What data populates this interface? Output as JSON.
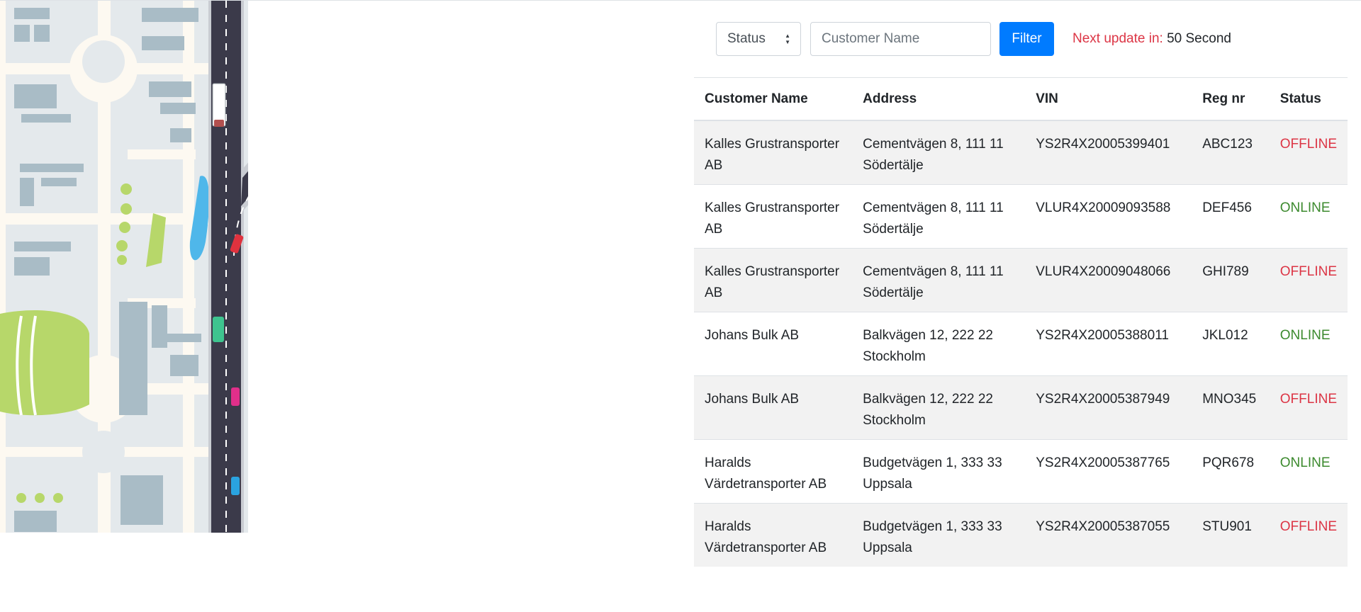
{
  "filter_bar": {
    "status_select_value": "Status",
    "customer_name_placeholder": "Customer Name",
    "filter_button_label": "Filter",
    "next_update_label": "Next update in:",
    "next_update_value": "50 Second"
  },
  "table": {
    "headers": [
      "Customer Name",
      "Address",
      "VIN",
      "Reg nr",
      "Status"
    ],
    "rows": [
      {
        "customer": "Kalles Grustransporter AB",
        "address": "Cementvägen 8, 111 11 Södertälje",
        "vin": "YS2R4X20005399401",
        "reg": "ABC123",
        "status": "OFFLINE"
      },
      {
        "customer": "Kalles Grustransporter AB",
        "address": "Cementvägen 8, 111 11 Södertälje",
        "vin": "VLUR4X20009093588",
        "reg": "DEF456",
        "status": "ONLINE"
      },
      {
        "customer": "Kalles Grustransporter AB",
        "address": "Cementvägen 8, 111 11 Södertälje",
        "vin": "VLUR4X20009048066",
        "reg": "GHI789",
        "status": "OFFLINE"
      },
      {
        "customer": "Johans Bulk AB",
        "address": "Balkvägen 12, 222 22 Stockholm",
        "vin": "YS2R4X20005388011",
        "reg": "JKL012",
        "status": "ONLINE"
      },
      {
        "customer": "Johans Bulk AB",
        "address": "Balkvägen 12, 222 22 Stockholm",
        "vin": "YS2R4X20005387949",
        "reg": "MNO345",
        "status": "OFFLINE"
      },
      {
        "customer": "Haralds Värdetransporter AB",
        "address": "Budgetvägen 1, 333 33 Uppsala",
        "vin": "YS2R4X20005387765",
        "reg": "PQR678",
        "status": "ONLINE"
      },
      {
        "customer": "Haralds Värdetransporter AB",
        "address": "Budgetvägen 1, 333 33 Uppsala",
        "vin": "YS2R4X20005387055",
        "reg": "STU901",
        "status": "OFFLINE"
      }
    ]
  },
  "colors": {
    "primary": "#007bff",
    "offline": "#dc3545",
    "online": "#3c8a2e",
    "stripe": "#f2f2f2"
  },
  "map_icon": "city-road-map-illustration"
}
